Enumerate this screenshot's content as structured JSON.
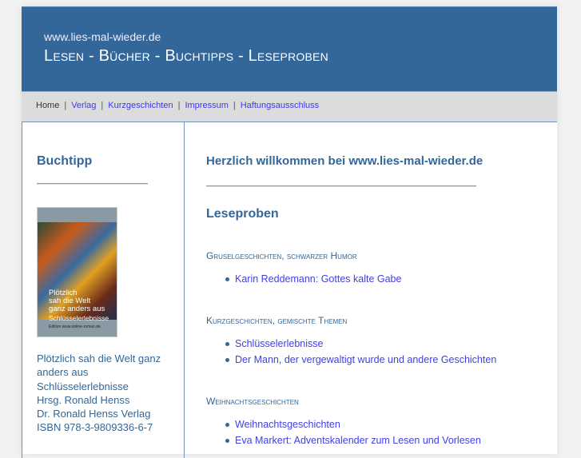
{
  "header": {
    "site": "www.lies-mal-wieder.de",
    "tagline": "Lesen - Bücher - Buchtipps - Leseproben"
  },
  "nav": [
    "Home",
    "Verlag",
    "Kurzgeschichten",
    "Impressum",
    "Haftungsausschluss"
  ],
  "sidebar": {
    "title": "Buchtipp",
    "cover": {
      "title_lines": [
        "Plötzlich",
        "sah die Welt",
        "ganz anders aus"
      ],
      "subtitle": "Schlüsselerlebnisse",
      "edition": "Edition www.online-roman.de"
    },
    "info": [
      "Plötzlich sah die Welt ganz anders aus",
      "Schlüsselerlebnisse",
      "Hrsg. Ronald Henss",
      "Dr. Ronald Henss Verlag",
      "ISBN 978-3-9809336-6-7"
    ]
  },
  "main": {
    "welcome": "Herzlich willkommen bei www.lies-mal-wieder.de",
    "section": "Leseproben",
    "categories": [
      {
        "title": "Gruselgeschichten, schwarzer Humor",
        "links": [
          "Karin Reddemann: Gottes kalte Gabe"
        ]
      },
      {
        "title": "Kurzgeschichten, gemischte Themen",
        "links": [
          "Schlüsselerlebnisse",
          "Der Mann, der vergewaltigt wurde und andere Geschichten"
        ]
      },
      {
        "title": "Weihnachtsgeschichten",
        "links": [
          "Weihnachtsgeschichten",
          "Eva Markert: Adventskalender zum Lesen und Vorlesen"
        ]
      }
    ]
  }
}
